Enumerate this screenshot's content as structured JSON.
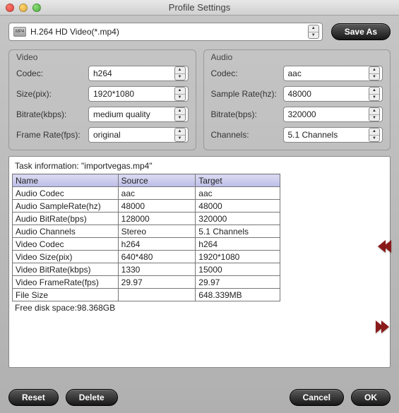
{
  "window": {
    "title": "Profile Settings"
  },
  "top": {
    "profile_label": "H.264 HD Video(*.mp4)",
    "icon_caption": "MP4",
    "save_as": "Save As"
  },
  "video_group": {
    "title": "Video",
    "codec_label": "Codec:",
    "codec_value": "h264",
    "size_label": "Size(pix):",
    "size_value": "1920*1080",
    "bitrate_label": "Bitrate(kbps):",
    "bitrate_value": "medium quality",
    "framerate_label": "Frame Rate(fps):",
    "framerate_value": "original"
  },
  "audio_group": {
    "title": "Audio",
    "codec_label": "Codec:",
    "codec_value": "aac",
    "samplerate_label": "Sample Rate(hz):",
    "samplerate_value": "48000",
    "bitrate_label": "Bitrate(bps):",
    "bitrate_value": "320000",
    "channels_label": "Channels:",
    "channels_value": "5.1 Channels"
  },
  "task": {
    "title": "Task information: \"importvegas.mp4\"",
    "headers": {
      "name": "Name",
      "source": "Source",
      "target": "Target"
    },
    "rows": [
      {
        "name": "Audio Codec",
        "source": "aac",
        "target": "aac"
      },
      {
        "name": "Audio SampleRate(hz)",
        "source": "48000",
        "target": "48000"
      },
      {
        "name": "Audio BitRate(bps)",
        "source": "128000",
        "target": "320000"
      },
      {
        "name": "Audio Channels",
        "source": "Stereo",
        "target": "5.1 Channels"
      },
      {
        "name": "Video Codec",
        "source": "h264",
        "target": "h264"
      },
      {
        "name": "Video Size(pix)",
        "source": "640*480",
        "target": "1920*1080"
      },
      {
        "name": "Video BitRate(kbps)",
        "source": "1330",
        "target": "15000"
      },
      {
        "name": "Video FrameRate(fps)",
        "source": "29.97",
        "target": "29.97"
      },
      {
        "name": "File Size",
        "source": "",
        "target": "648.339MB"
      }
    ],
    "free_space": "Free disk space:98.368GB"
  },
  "buttons": {
    "reset": "Reset",
    "delete": "Delete",
    "cancel": "Cancel",
    "ok": "OK"
  }
}
